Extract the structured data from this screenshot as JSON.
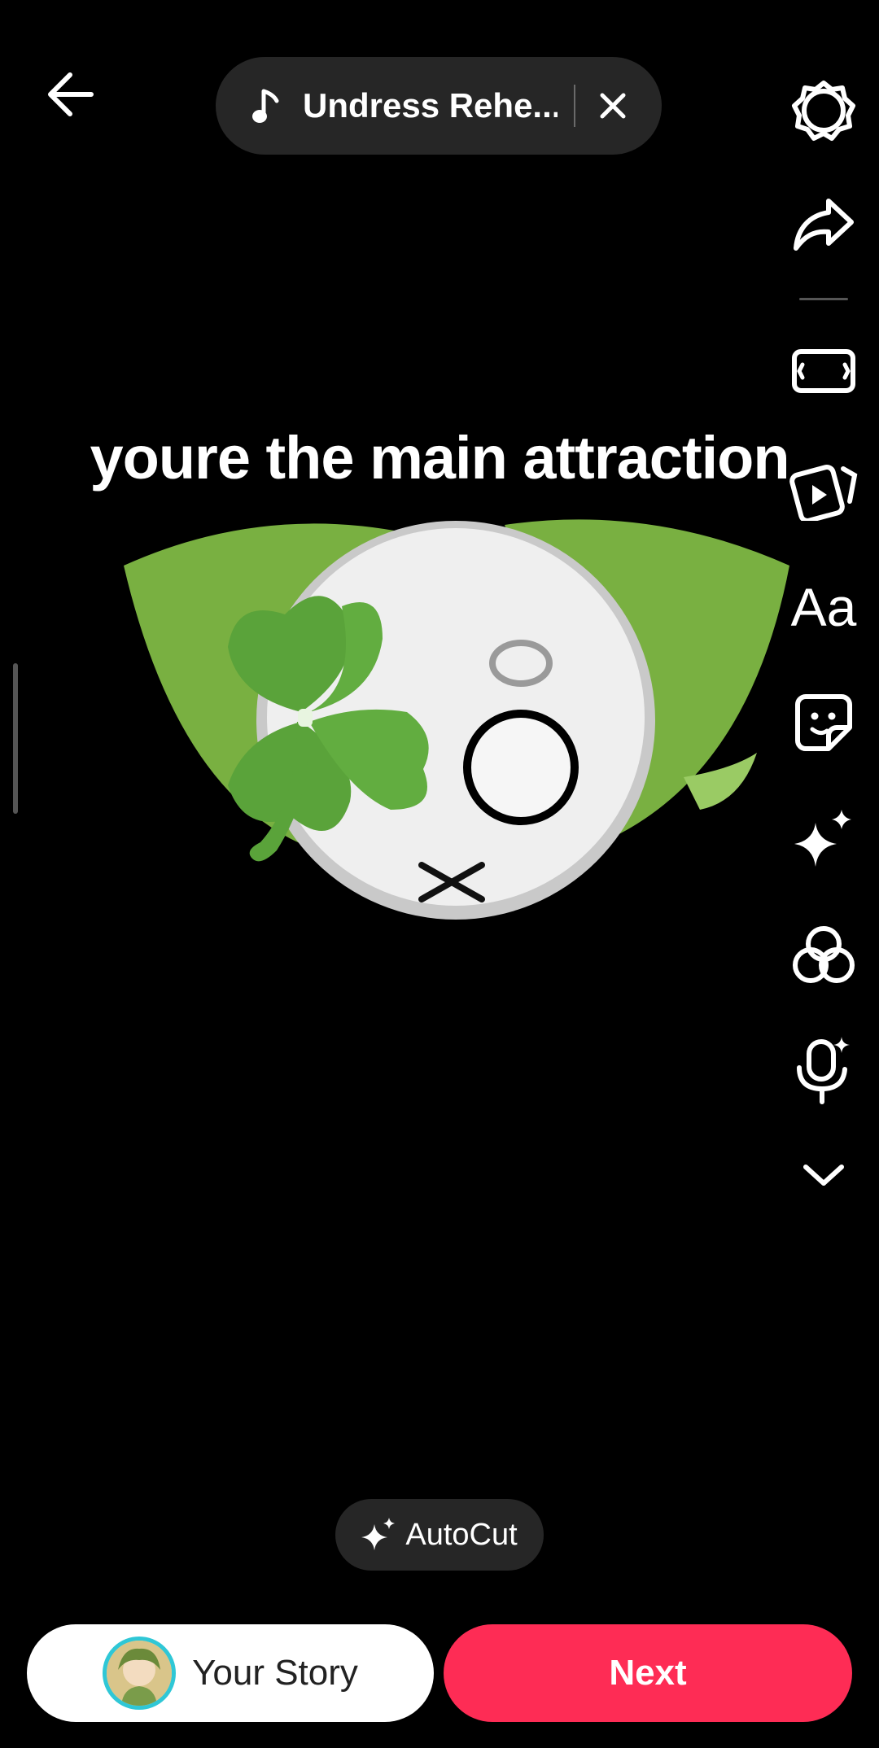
{
  "header": {
    "sound_title": "Undress Rehe..."
  },
  "caption": "youre the main attraction",
  "right_rail": {
    "icons": [
      "settings-icon",
      "share-icon",
      "aspect-ratio-icon",
      "templates-icon",
      "text-icon",
      "sticker-icon",
      "effects-icon",
      "filters-icon",
      "voice-effects-icon",
      "chevron-down-icon"
    ],
    "text_tool_label": "Aa"
  },
  "autocut": {
    "label": "AutoCut"
  },
  "footer": {
    "your_story_label": "Your Story",
    "next_label": "Next"
  },
  "colors": {
    "next_button": "#fe2c55",
    "story_ring": "#2fc7d6",
    "leaf_green": "#79b041",
    "clover_green": "#5aa33a"
  }
}
